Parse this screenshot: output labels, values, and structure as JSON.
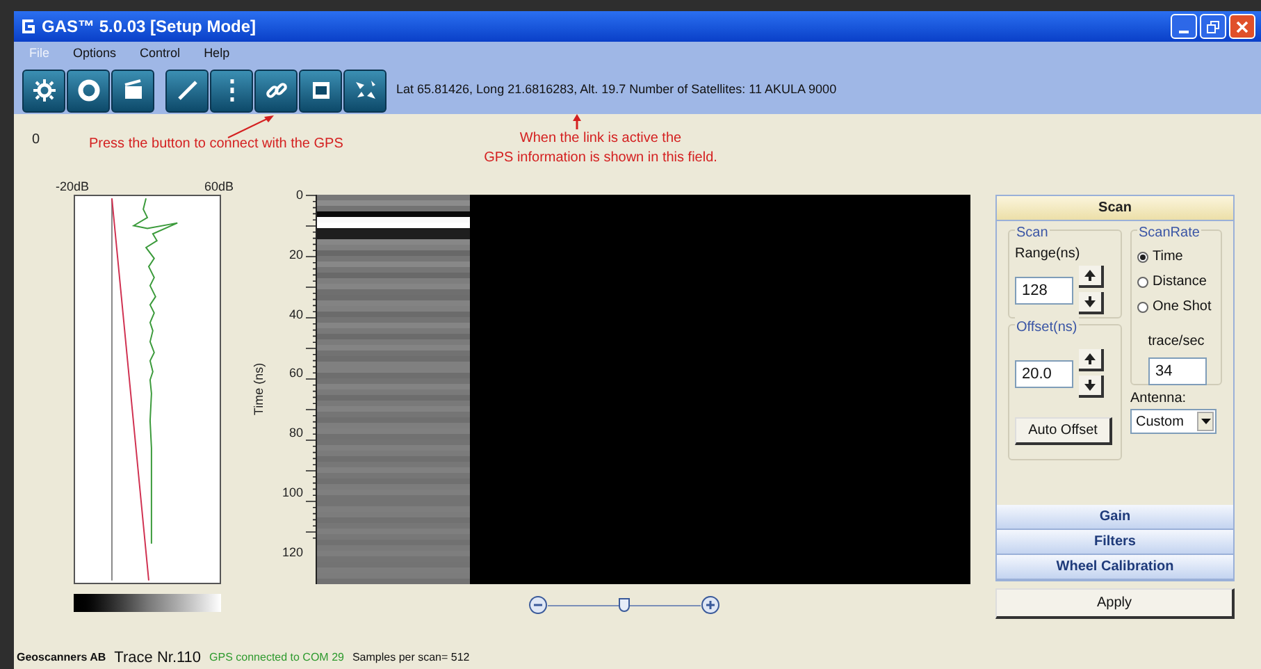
{
  "window": {
    "title": "GAS™ 5.0.03 [Setup Mode]"
  },
  "menu": [
    {
      "label": "File",
      "disabled": true
    },
    {
      "label": "Options",
      "disabled": false
    },
    {
      "label": "Control",
      "disabled": false
    },
    {
      "label": "Help",
      "disabled": false
    }
  ],
  "toolbar": {
    "gps_info": "Lat 65.81426, Long 21.6816283, Alt. 19.7 Number of  Satellites: 11  AKULA 9000"
  },
  "counter": "0",
  "annotations": [
    {
      "text": "Press the button to connect with the GPS"
    },
    {
      "text": "When the link is active the\nGPS information is shown in this field."
    }
  ],
  "signal_plot": {
    "min_label": "-20dB",
    "max_label": "60dB"
  },
  "radargram": {
    "axis_title": "Time (ns)",
    "ticks": [
      "0",
      "20",
      "40",
      "60",
      "80",
      "100",
      "120"
    ]
  },
  "zoom_slider": {
    "level": 0.5
  },
  "panel": {
    "sections": [
      {
        "label": "Scan",
        "expanded": true
      },
      {
        "label": "Gain",
        "expanded": false
      },
      {
        "label": "Filters",
        "expanded": false
      },
      {
        "label": "Wheel Calibration",
        "expanded": false
      }
    ],
    "scan": {
      "title": "Scan",
      "range_label": "Range(ns)",
      "range_value": "128"
    },
    "offset": {
      "title": "Offset(ns)",
      "value": "20.0",
      "button": "Auto Offset"
    },
    "scan_rate": {
      "title": "ScanRate",
      "options": [
        {
          "label": "Time",
          "selected": true
        },
        {
          "label": "Distance",
          "selected": false
        },
        {
          "label": "One Shot",
          "selected": false
        }
      ],
      "rate_label": "trace/sec",
      "rate_value": "34"
    },
    "antenna": {
      "label": "Antenna:",
      "value": "Custom"
    },
    "apply_button": "Apply"
  },
  "status_bar": {
    "company": "Geoscanners AB",
    "trace": "Trace Nr.110",
    "gps_status": "GPS connected to COM 29",
    "samples": "Samples per scan= 512"
  }
}
